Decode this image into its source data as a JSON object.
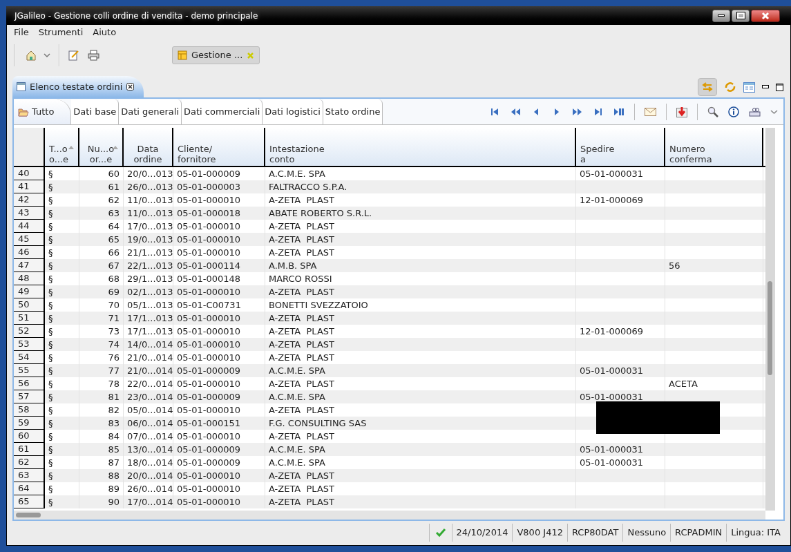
{
  "window": {
    "title": "JGalileo - Gestione colli ordine di vendita - demo principale"
  },
  "menu": [
    "File",
    "Strumenti",
    "Aiuto"
  ],
  "editor_tab": {
    "label": "Gestione ..."
  },
  "view_tab": {
    "label": "Elenco testate ordini"
  },
  "filter_tabs": [
    {
      "label": "Tutto",
      "selected": true
    },
    {
      "label": "Dati base",
      "selected": false
    },
    {
      "label": "Dati generali",
      "selected": false
    },
    {
      "label": "Dati commerciali",
      "selected": false
    },
    {
      "label": "Dati logistici",
      "selected": false
    },
    {
      "label": "Stato ordine",
      "selected": false
    }
  ],
  "table": {
    "columns": [
      {
        "label": "T...o\no...e",
        "sorted": true
      },
      {
        "label": "Nu...o\nor...e",
        "sorted": true
      },
      {
        "label": "Data\nordine",
        "sorted": false
      },
      {
        "label": "Cliente/\nfornitore",
        "sorted": false
      },
      {
        "label": "Intestazione\nconto",
        "sorted": false
      },
      {
        "label": "Spedire\na",
        "sorted": false
      },
      {
        "label": "Numero\nconferma",
        "sorted": false
      }
    ],
    "rows": [
      {
        "row": "40",
        "tipo": "§",
        "numero": "60",
        "data": "20/0...013",
        "cliente": "05-01-000009",
        "intestazione": "A.C.M.E. SPA",
        "spedire": "05-01-000031"
      },
      {
        "row": "41",
        "tipo": "§",
        "numero": "61",
        "data": "26/0...013",
        "cliente": "05-01-000003",
        "intestazione": "FALTRACCO S.P.A."
      },
      {
        "row": "42",
        "tipo": "§",
        "numero": "62",
        "data": "11/0...013",
        "cliente": "05-01-000010",
        "intestazione": "A-ZETA  PLAST",
        "spedire": "12-01-000069"
      },
      {
        "row": "43",
        "tipo": "§",
        "numero": "63",
        "data": "11/0...013",
        "cliente": "05-01-000018",
        "intestazione": "ABATE ROBERTO S.R.L."
      },
      {
        "row": "44",
        "tipo": "§",
        "numero": "64",
        "data": "17/0...013",
        "cliente": "05-01-000010",
        "intestazione": "A-ZETA  PLAST"
      },
      {
        "row": "45",
        "tipo": "§",
        "numero": "65",
        "data": "19/0...013",
        "cliente": "05-01-000010",
        "intestazione": "A-ZETA  PLAST"
      },
      {
        "row": "46",
        "tipo": "§",
        "numero": "66",
        "data": "21/1...013",
        "cliente": "05-01-000010",
        "intestazione": "A-ZETA  PLAST"
      },
      {
        "row": "47",
        "tipo": "§",
        "numero": "67",
        "data": "22/1...013",
        "cliente": "05-01-000114",
        "intestazione": "A.M.B. SPA",
        "conferma": "56"
      },
      {
        "row": "48",
        "tipo": "§",
        "numero": "68",
        "data": "29/1...013",
        "cliente": "05-01-000148",
        "intestazione": "MARCO ROSSI"
      },
      {
        "row": "49",
        "tipo": "§",
        "numero": "69",
        "data": "02/1...013",
        "cliente": "05-01-000010",
        "intestazione": "A-ZETA  PLAST"
      },
      {
        "row": "50",
        "tipo": "§",
        "numero": "70",
        "data": "05/1...013",
        "cliente": "05-01-C00731",
        "intestazione": "BONETTI SVEZZATOIO"
      },
      {
        "row": "51",
        "tipo": "§",
        "numero": "71",
        "data": "17/1...013",
        "cliente": "05-01-000010",
        "intestazione": "A-ZETA  PLAST"
      },
      {
        "row": "52",
        "tipo": "§",
        "numero": "73",
        "data": "17/1...013",
        "cliente": "05-01-000010",
        "intestazione": "A-ZETA  PLAST",
        "spedire": "12-01-000069"
      },
      {
        "row": "53",
        "tipo": "§",
        "numero": "74",
        "data": "14/0...014",
        "cliente": "05-01-000010",
        "intestazione": "A-ZETA  PLAST"
      },
      {
        "row": "54",
        "tipo": "§",
        "numero": "76",
        "data": "21/0...014",
        "cliente": "05-01-000010",
        "intestazione": "A-ZETA  PLAST"
      },
      {
        "row": "55",
        "tipo": "§",
        "numero": "77",
        "data": "21/0...014",
        "cliente": "05-01-000009",
        "intestazione": "A.C.M.E. SPA",
        "spedire": "05-01-000031"
      },
      {
        "row": "56",
        "tipo": "§",
        "numero": "78",
        "data": "22/0...014",
        "cliente": "05-01-000010",
        "intestazione": "A-ZETA  PLAST",
        "conferma": "ACETA"
      },
      {
        "row": "57",
        "tipo": "§",
        "numero": "81",
        "data": "23/0...014",
        "cliente": "05-01-000009",
        "intestazione": "A.C.M.E. SPA",
        "spedire": "05-01-000031"
      },
      {
        "row": "58",
        "tipo": "§",
        "numero": "82",
        "data": "05/0...014",
        "cliente": "05-01-000010",
        "intestazione": "A-ZETA  PLAST"
      },
      {
        "row": "59",
        "tipo": "§",
        "numero": "83",
        "data": "06/0...014",
        "cliente": "05-01-000151",
        "intestazione": "F.G. CONSULTING SAS"
      },
      {
        "row": "60",
        "tipo": "§",
        "numero": "84",
        "data": "07/0...014",
        "cliente": "05-01-000010",
        "intestazione": "A-ZETA  PLAST"
      },
      {
        "row": "61",
        "tipo": "§",
        "numero": "85",
        "data": "13/0...014",
        "cliente": "05-01-000009",
        "intestazione": "A.C.M.E. SPA",
        "spedire": "05-01-000031"
      },
      {
        "row": "62",
        "tipo": "§",
        "numero": "87",
        "data": "18/0...014",
        "cliente": "05-01-000009",
        "intestazione": "A.C.M.E. SPA",
        "spedire": "05-01-000031"
      },
      {
        "row": "63",
        "tipo": "§",
        "numero": "88",
        "data": "20/0...014",
        "cliente": "05-01-000010",
        "intestazione": "A-ZETA  PLAST"
      },
      {
        "row": "64",
        "tipo": "§",
        "numero": "89",
        "data": "26/0...014",
        "cliente": "05-01-000010",
        "intestazione": "A-ZETA  PLAST"
      },
      {
        "row": "65",
        "tipo": "§",
        "numero": "90",
        "data": "17/0...014",
        "cliente": "05-01-000010",
        "intestazione": "A-ZETA  PLAST"
      }
    ]
  },
  "status_bar": [
    "24/10/2014",
    "V800 J412",
    "RCP80DAT",
    "Nessuno",
    "RCPADMIN",
    "Lingua: ITA"
  ]
}
